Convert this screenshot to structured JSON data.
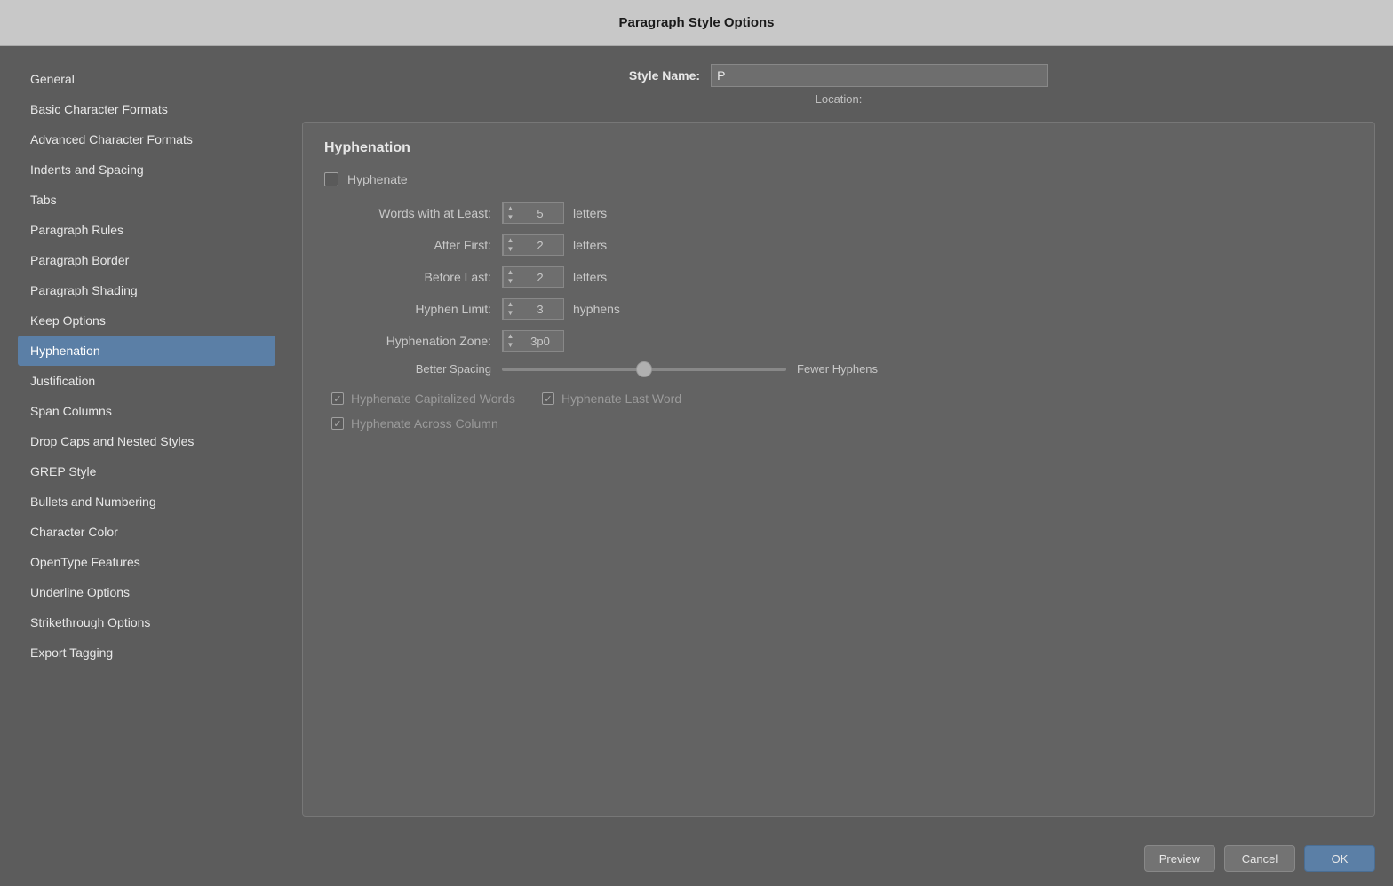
{
  "titleBar": {
    "title": "Paragraph Style Options"
  },
  "styleNameRow": {
    "label": "Style Name:",
    "value": "P",
    "locationLabel": "Location:"
  },
  "sidebar": {
    "items": [
      {
        "id": "general",
        "label": "General",
        "active": false
      },
      {
        "id": "basic-character-formats",
        "label": "Basic Character Formats",
        "active": false
      },
      {
        "id": "advanced-character-formats",
        "label": "Advanced Character Formats",
        "active": false
      },
      {
        "id": "indents-and-spacing",
        "label": "Indents and Spacing",
        "active": false
      },
      {
        "id": "tabs",
        "label": "Tabs",
        "active": false
      },
      {
        "id": "paragraph-rules",
        "label": "Paragraph Rules",
        "active": false
      },
      {
        "id": "paragraph-border",
        "label": "Paragraph Border",
        "active": false
      },
      {
        "id": "paragraph-shading",
        "label": "Paragraph Shading",
        "active": false
      },
      {
        "id": "keep-options",
        "label": "Keep Options",
        "active": false
      },
      {
        "id": "hyphenation",
        "label": "Hyphenation",
        "active": true
      },
      {
        "id": "justification",
        "label": "Justification",
        "active": false
      },
      {
        "id": "span-columns",
        "label": "Span Columns",
        "active": false
      },
      {
        "id": "drop-caps-and-nested-styles",
        "label": "Drop Caps and Nested Styles",
        "active": false
      },
      {
        "id": "grep-style",
        "label": "GREP Style",
        "active": false
      },
      {
        "id": "bullets-and-numbering",
        "label": "Bullets and Numbering",
        "active": false
      },
      {
        "id": "character-color",
        "label": "Character Color",
        "active": false
      },
      {
        "id": "opentype-features",
        "label": "OpenType Features",
        "active": false
      },
      {
        "id": "underline-options",
        "label": "Underline Options",
        "active": false
      },
      {
        "id": "strikethrough-options",
        "label": "Strikethrough Options",
        "active": false
      },
      {
        "id": "export-tagging",
        "label": "Export Tagging",
        "active": false
      }
    ]
  },
  "main": {
    "sectionTitle": "Hyphenation",
    "hyphenateCheckbox": {
      "label": "Hyphenate",
      "checked": false
    },
    "fields": [
      {
        "label": "Words with at Least:",
        "value": "5",
        "unit": "letters"
      },
      {
        "label": "After First:",
        "value": "2",
        "unit": "letters"
      },
      {
        "label": "Before Last:",
        "value": "2",
        "unit": "letters"
      },
      {
        "label": "Hyphen Limit:",
        "value": "3",
        "unit": "hyphens"
      },
      {
        "label": "Hyphenation Zone:",
        "value": "3p0",
        "unit": ""
      }
    ],
    "slider": {
      "leftLabel": "Better Spacing",
      "rightLabel": "Fewer Hyphens",
      "value": 50
    },
    "checkboxes": [
      [
        {
          "id": "hyphenate-capitalized",
          "label": "Hyphenate Capitalized Words",
          "checked": true
        },
        {
          "id": "hyphenate-last-word",
          "label": "Hyphenate Last Word",
          "checked": true
        }
      ],
      [
        {
          "id": "hyphenate-across-column",
          "label": "Hyphenate Across Column",
          "checked": true
        }
      ]
    ]
  },
  "buttons": {
    "cancel": "Cancel",
    "ok": "OK",
    "preview": "Preview"
  }
}
